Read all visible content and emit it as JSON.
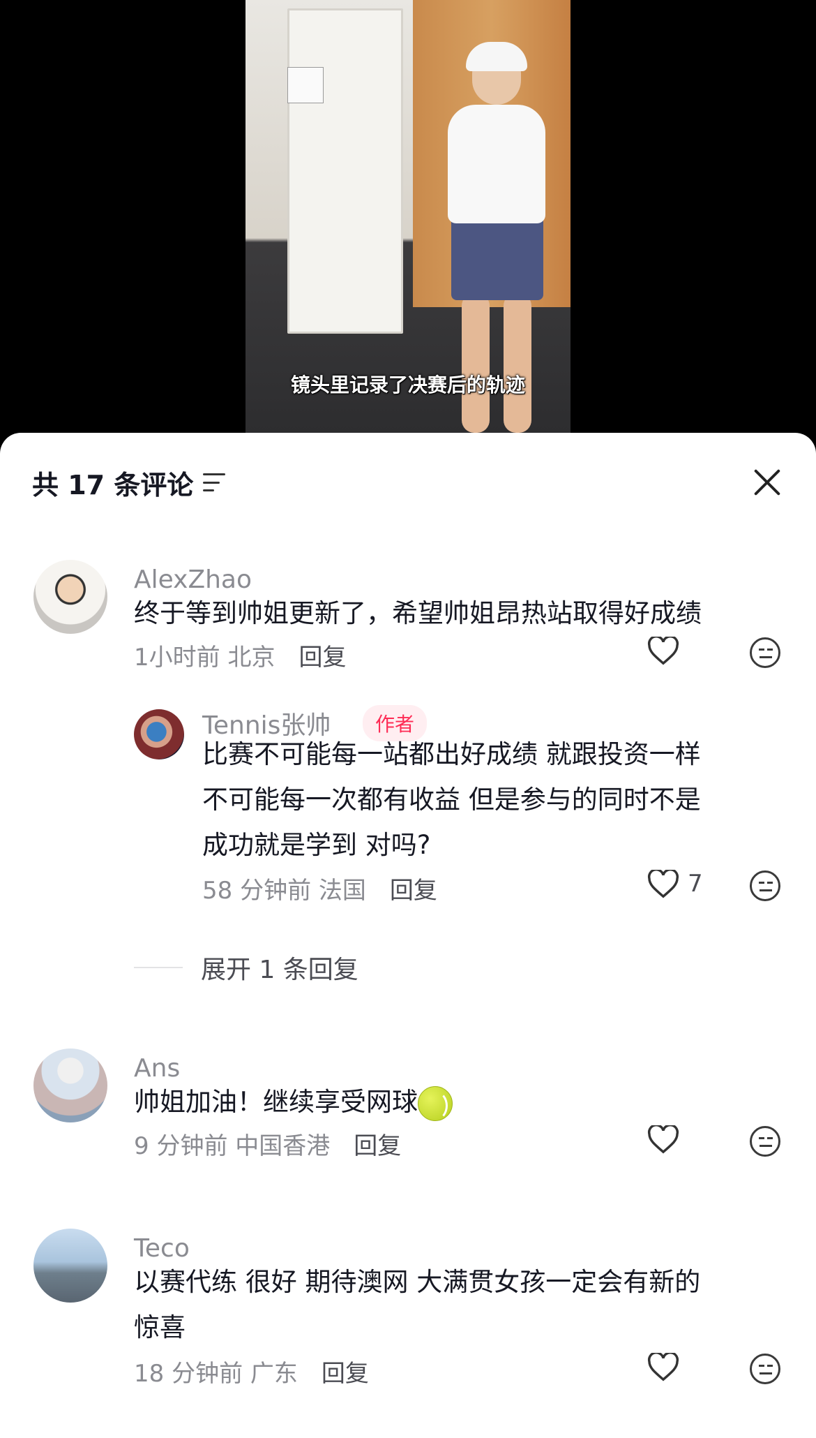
{
  "video": {
    "caption": "镜头里记录了决赛后的轨迹"
  },
  "header": {
    "title": "共 17 条评论"
  },
  "comments": [
    {
      "username": "AlexZhao",
      "text": "终于等到帅姐更新了，希望帅姐昂热站取得好成绩",
      "time": "1小时前",
      "location": "北京",
      "reply": "回复"
    },
    {
      "username": "Tennis张帅",
      "badge": "作者",
      "text_lines": [
        "比赛不可能每一站都出好成绩 就跟投资一样",
        "不可能每一次都有收益 但是参与的同时不是",
        "成功就是学到 对吗?"
      ],
      "time": "58 分钟前",
      "location": "法国",
      "reply": "回复",
      "likes": "7",
      "expand": "展开 1 条回复"
    },
    {
      "username": "Ans",
      "text": "帅姐加油！继续享受网球",
      "time": "9 分钟前",
      "location": "中国香港",
      "reply": "回复"
    },
    {
      "username": "Teco",
      "text_lines": [
        "以赛代练 很好 期待澳网 大满贯女孩一定会有新的",
        "惊喜"
      ],
      "time": "18 分钟前",
      "location": "广东",
      "reply": "回复"
    }
  ]
}
